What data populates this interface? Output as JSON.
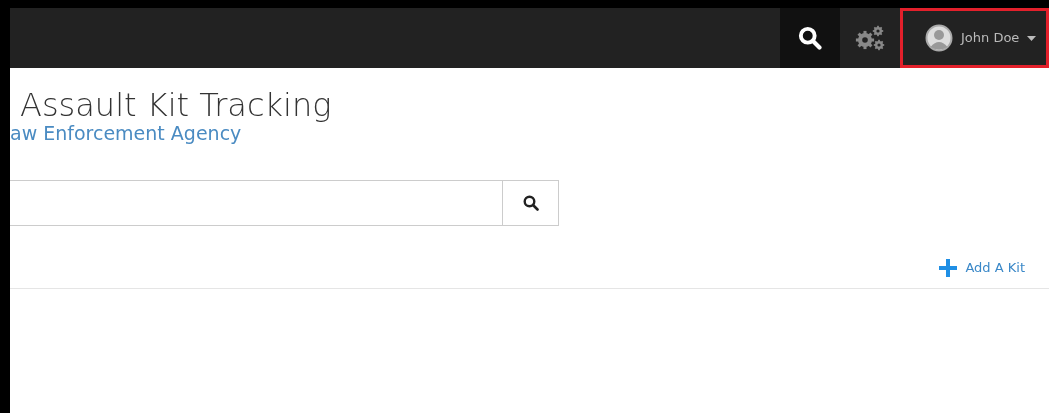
{
  "navbar": {
    "items": [
      {
        "kind": "search",
        "selected": true
      },
      {
        "kind": "settings",
        "selected": false
      }
    ],
    "user_menu": {
      "name": "John Doe",
      "highlighted": true
    }
  },
  "header": {
    "title": "Assault Kit Tracking",
    "subtitle": "aw Enforcement Agency"
  },
  "actions": [
    {
      "label": "Add A Kit"
    }
  ]
}
